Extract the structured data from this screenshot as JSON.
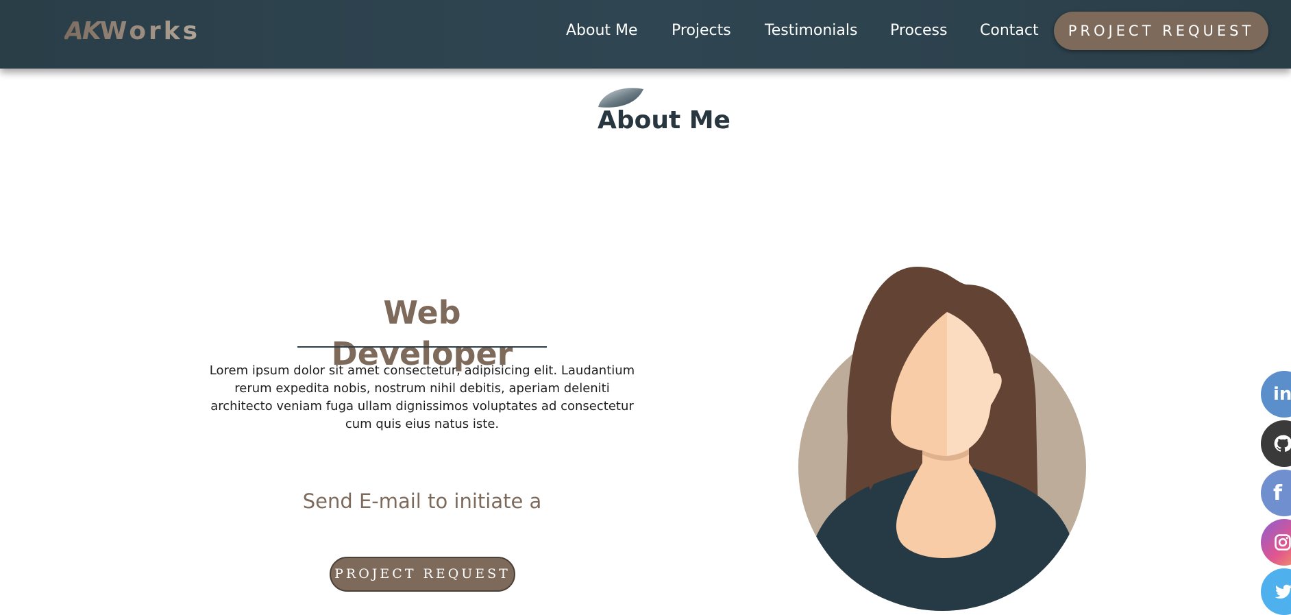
{
  "header": {
    "logo_ak": "AK",
    "logo_rest": "Works",
    "nav": [
      {
        "label": "About Me"
      },
      {
        "label": "Projects"
      },
      {
        "label": "Testimonials"
      },
      {
        "label": "Process"
      },
      {
        "label": "Contact"
      }
    ],
    "cta_label": "PROJECT REQUEST"
  },
  "section": {
    "title": "About Me"
  },
  "about": {
    "role": "Web Developer",
    "bio": "Lorem ipsum dolor sit amet consectetur, adipisicing elit. Laudantium rerum expedita nobis, nostrum nihil debitis, aperiam deleniti architecto veniam fuga ullam dignissimos voluptates ad consectetur cum quis eius natus iste.",
    "email_prompt": "Send E-mail to initiate a",
    "cta_label": "PROJECT REQUEST"
  },
  "social": [
    {
      "name": "linkedin-icon",
      "glyph": "in",
      "color": "#5b8fcc"
    },
    {
      "name": "github-icon",
      "glyph": "",
      "color": "#3a3a3a"
    },
    {
      "name": "facebook-icon",
      "glyph": "f",
      "color": "#6f8fcf"
    },
    {
      "name": "instagram-icon",
      "glyph": "",
      "color": "#d85c9a"
    },
    {
      "name": "twitter-icon",
      "glyph": "",
      "color": "#4fb0ee"
    }
  ],
  "colors": {
    "header_bg": "#2f4652",
    "accent_brown": "#7d6a5b",
    "heading_dark": "#27363f"
  }
}
